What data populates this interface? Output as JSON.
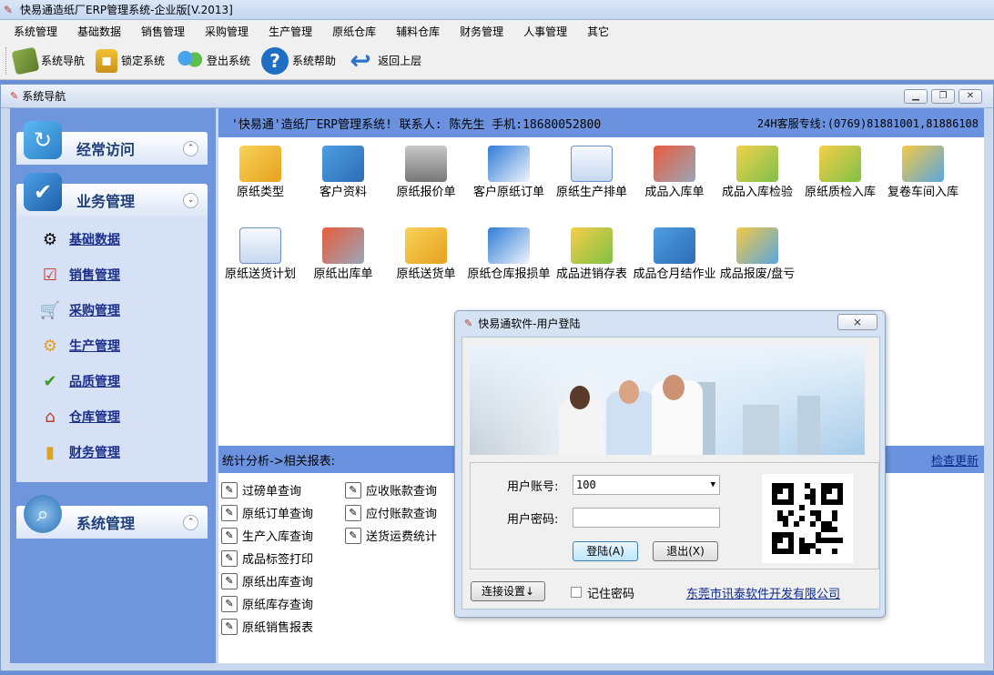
{
  "app": {
    "title": "快易通造纸厂ERP管理系统-企业版[V.2013]"
  },
  "menu": [
    "系统管理",
    "基础数据",
    "销售管理",
    "采购管理",
    "生产管理",
    "原纸仓库",
    "辅料仓库",
    "财务管理",
    "人事管理",
    "其它"
  ],
  "toolbar": [
    {
      "label": "系统导航",
      "icon": "book-icon"
    },
    {
      "label": "锁定系统",
      "icon": "lock-icon"
    },
    {
      "label": "登出系统",
      "icon": "users-icon"
    },
    {
      "label": "系统帮助",
      "icon": "help-icon"
    },
    {
      "label": "返回上层",
      "icon": "back-arrow-icon"
    }
  ],
  "nav_window": {
    "title": "系统导航"
  },
  "sidebar": {
    "groups": [
      {
        "label": "经常访问",
        "state": "collapsed"
      },
      {
        "label": "业务管理",
        "state": "expanded"
      },
      {
        "label": "系统管理",
        "state": "collapsed"
      }
    ],
    "items": [
      {
        "label": "基础数据",
        "icon": "gear-globe-icon"
      },
      {
        "label": "销售管理",
        "icon": "checklist-icon"
      },
      {
        "label": "采购管理",
        "icon": "cart-icon"
      },
      {
        "label": "生产管理",
        "icon": "gear-icon"
      },
      {
        "label": "品质管理",
        "icon": "check-folder-icon"
      },
      {
        "label": "仓库管理",
        "icon": "house-icon"
      },
      {
        "label": "财务管理",
        "icon": "bar-chart-icon"
      }
    ]
  },
  "info_bar": {
    "left": "'快易通'造纸厂ERP管理系统! 联系人:  陈先生  手机:18680052800",
    "right": "24H客服专线:(0769)81881001,81886108"
  },
  "modules": [
    {
      "label": "原纸类型"
    },
    {
      "label": "客户资料"
    },
    {
      "label": "原纸报价单"
    },
    {
      "label": "客户原纸订单"
    },
    {
      "label": "原纸生产排单"
    },
    {
      "label": "成品入库单"
    },
    {
      "label": "成品入库检验"
    },
    {
      "label": "原纸质检入库"
    },
    {
      "label": "复卷车间入库"
    },
    {
      "label": "原纸送货计划"
    },
    {
      "label": "原纸出库单"
    },
    {
      "label": "原纸送货单"
    },
    {
      "label": "原纸仓库报损单"
    },
    {
      "label": "成品进销存表"
    },
    {
      "label": "成品仓月结作业"
    },
    {
      "label": "成品报废/盘亏"
    }
  ],
  "stats": {
    "title": "统计分析->相关报表:",
    "link": "检查更新"
  },
  "reports_col1": [
    "过磅单查询",
    "原纸订单查询",
    "生产入库查询",
    "成品标签打印",
    "原纸出库查询",
    "原纸库存查询",
    "原纸销售报表"
  ],
  "reports_col2": [
    "应收账款查询",
    "应付账款查询",
    "送货运费统计"
  ],
  "login": {
    "title": "快易通软件-用户登陆",
    "close": "⨯",
    "account_label": "用户账号:",
    "account_value": "100",
    "password_label": "用户密码:",
    "password_value": "",
    "login_btn": "登陆(A)",
    "exit_btn": "退出(X)",
    "connect_btn": "连接设置↓",
    "remember_label": "记住密码",
    "company": "东莞市讯泰软件开发有限公司"
  }
}
